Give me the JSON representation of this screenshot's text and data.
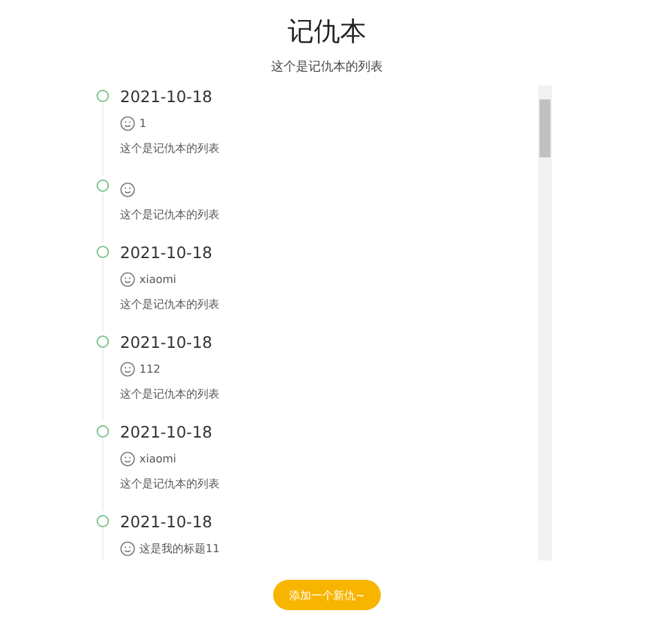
{
  "title": "记仇本",
  "subtitle": "这个是记仇本的列表",
  "items": [
    {
      "date": "2021-10-18",
      "name": "1",
      "description": "这个是记仇本的列表"
    },
    {
      "description": "这个是记仇本的列表"
    },
    {
      "date": "2021-10-18",
      "name": "xiaomi",
      "description": "这个是记仇本的列表"
    },
    {
      "date": "2021-10-18",
      "name": "112",
      "description": "这个是记仇本的列表"
    },
    {
      "date": "2021-10-18",
      "name": "xiaomi",
      "description": "这个是记仇本的列表"
    },
    {
      "date": "2021-10-18",
      "name": "这是我的标题11"
    }
  ],
  "add_button": "添加一个新仇~"
}
